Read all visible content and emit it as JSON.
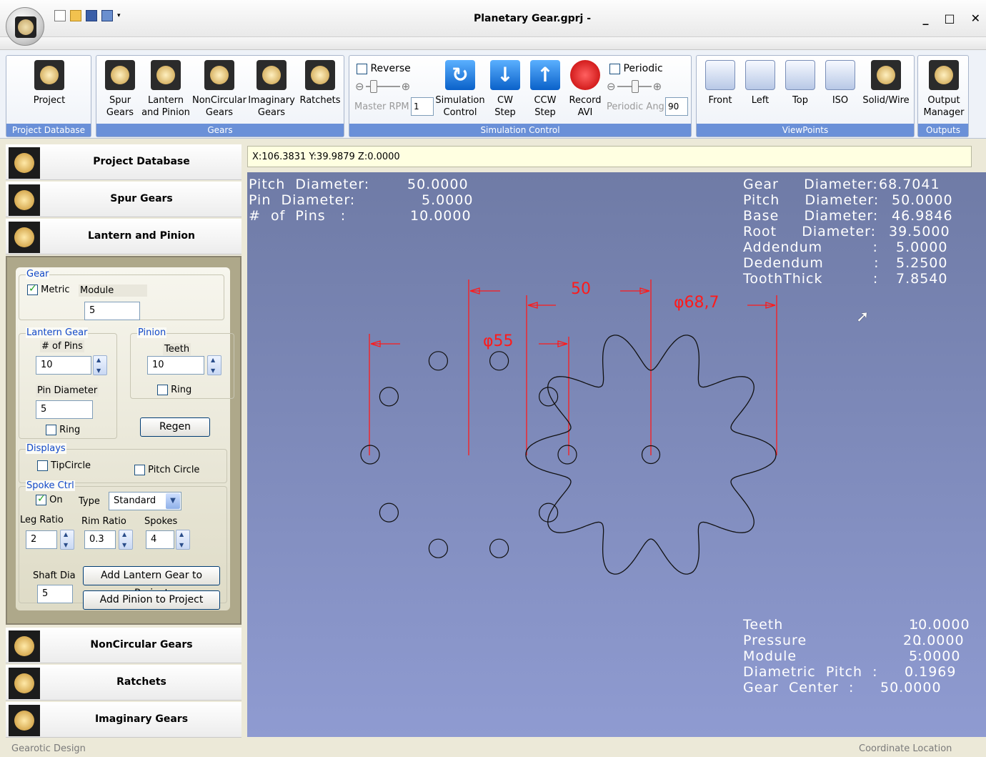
{
  "window": {
    "title": "Planetary Gear.gprj -",
    "minimize": "_",
    "maximize": "□",
    "close": "✕"
  },
  "qat": {
    "dropdown": "▾"
  },
  "ribbon": {
    "project_db": {
      "project_label": "Project",
      "group_label": "Project Database"
    },
    "gears": {
      "spur": [
        "Spur",
        "Gears"
      ],
      "lantern": [
        "Lantern",
        "and Pinion"
      ],
      "noncircular": [
        "NonCircular",
        "Gears"
      ],
      "imaginary": [
        "Imaginary",
        "Gears"
      ],
      "ratchets": "Ratchets",
      "group_label": "Gears"
    },
    "sim": {
      "reverse_label": "Reverse",
      "reverse_checked": false,
      "master_rpm_label": "Master RPM",
      "master_rpm_value": "1",
      "simulation": [
        "Simulation",
        "Control"
      ],
      "cw": [
        "CW",
        "Step"
      ],
      "ccw": [
        "CCW",
        "Step"
      ],
      "record": [
        "Record",
        "AVI"
      ],
      "periodic_label": "Periodic",
      "periodic_checked": false,
      "periodic_ang_label": "Periodic Ang",
      "periodic_ang_value": "90",
      "group_label": "Simulation Control"
    },
    "viewpoints": {
      "front": "Front",
      "left": "Left",
      "top": "Top",
      "iso": "ISO",
      "solid": "Solid/Wire",
      "group_label": "ViewPoints"
    },
    "outputs": {
      "output": [
        "Output",
        "Manager"
      ],
      "group_label": "Outputs"
    }
  },
  "nav": {
    "project_database": "Project Database",
    "spur_gears": "Spur Gears",
    "lantern_pinion": "Lantern and Pinion",
    "noncircular": "NonCircular Gears",
    "ratchets": "Ratchets",
    "imaginary": "Imaginary Gears"
  },
  "form": {
    "gear_legend": "Gear",
    "metric_label": "Metric",
    "metric_checked": true,
    "module_label": "Module",
    "module_value": "5",
    "lantern_legend": "Lantern Gear",
    "pins_label": "# of Pins",
    "pins_value": "10",
    "pin_dia_label": "Pin Diameter",
    "pin_dia_value": "5",
    "lantern_ring_label": "Ring",
    "pinion_legend": "Pinion",
    "teeth_label": "Teeth",
    "teeth_value": "10",
    "pinion_ring_label": "Ring",
    "regen_label": "Regen",
    "displays_legend": "Displays",
    "tipcircle_label": "TipCircle",
    "pitchcircle_label": "Pitch Circle",
    "spoke_legend": "Spoke Ctrl",
    "spoke_on_label": "On",
    "spoke_on_checked": true,
    "type_label": "Type",
    "type_value": "Standard",
    "leg_ratio_label": "Leg Ratio",
    "leg_ratio_value": "2",
    "rim_ratio_label": "Rim Ratio",
    "rim_ratio_value": "0.3",
    "spokes_label": "Spokes",
    "spokes_value": "4",
    "shaft_dia_label": "Shaft Dia",
    "shaft_dia_value": "5",
    "add_lantern_label": "Add Lantern Gear to Project",
    "add_pinion_label": "Add Pinion to Project"
  },
  "coords": "X:106.3831 Y:39.9879 Z:0.0000",
  "viewport": {
    "left_info": [
      {
        "label": "Pitch  Diameter:",
        "value": "50.0000"
      },
      {
        "label": "Pin  Diameter:",
        "value": "5.0000"
      },
      {
        "label": "#  of  Pins   :",
        "value": "10.0000"
      }
    ],
    "right_info": [
      {
        "label": "Gear     Diameter:",
        "value": "68.7041"
      },
      {
        "label": "Pitch     Diameter:",
        "value": "50.0000"
      },
      {
        "label": "Base     Diameter:",
        "value": "46.9846"
      },
      {
        "label": "Root     Diameter:",
        "value": "39.5000"
      },
      {
        "label": "Addendum          :",
        "value": "5.0000"
      },
      {
        "label": "Dedendum          :",
        "value": "5.2500"
      },
      {
        "label": "ToothThick          :",
        "value": "7.8540"
      }
    ],
    "bottom_info": [
      {
        "label": "Teeth                          :",
        "value": "10.0000"
      },
      {
        "label": "Pressure                      :",
        "value": "20.0000"
      },
      {
        "label": "Module                        :",
        "value": "5.0000"
      },
      {
        "label": "Diametric  Pitch  :",
        "value": "0.1969"
      },
      {
        "label": "Gear  Center  :",
        "value": "50.0000"
      }
    ],
    "dim_50": "50",
    "dim_55": "φ55",
    "dim_68": "φ68,7",
    "colors": {
      "dimension": "#ff1a1a",
      "outline": "#111111",
      "background_top": "#6f7ba6",
      "background_bottom": "#8f9bd1"
    }
  },
  "status": {
    "left": "Gearotic Design",
    "right": "Coordinate Location"
  }
}
